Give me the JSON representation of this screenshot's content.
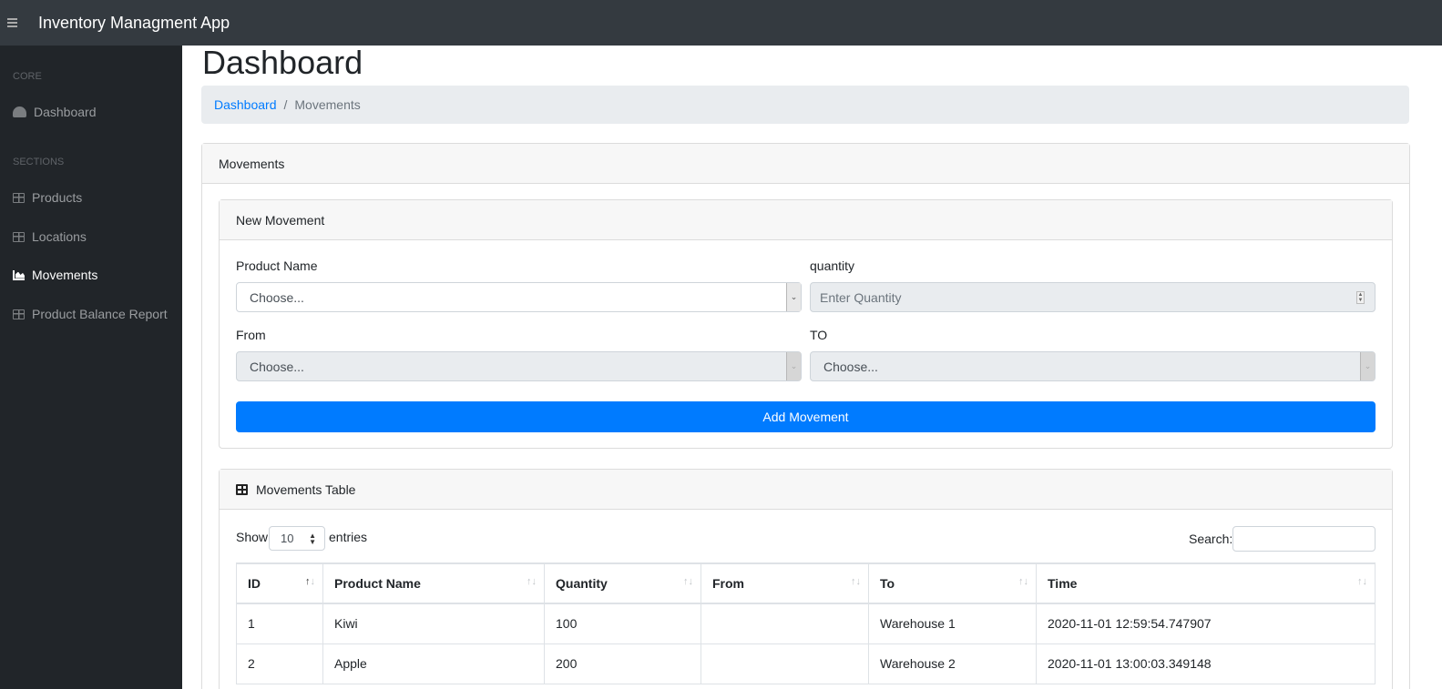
{
  "app": {
    "title": "Inventory Managment App"
  },
  "sidebar": {
    "headings": [
      "CORE",
      "SECTIONS"
    ],
    "items": [
      {
        "label": "Dashboard",
        "icon": "tachometer-icon",
        "active": false
      },
      {
        "label": "Products",
        "icon": "table-icon",
        "active": false
      },
      {
        "label": "Locations",
        "icon": "table-icon",
        "active": false
      },
      {
        "label": "Movements",
        "icon": "area-chart-icon",
        "active": true
      },
      {
        "label": "Product Balance Report",
        "icon": "table-icon",
        "active": false
      }
    ]
  },
  "page": {
    "title": "Dashboard",
    "breadcrumb": [
      {
        "label": "Dashboard",
        "link": true
      },
      {
        "label": "Movements",
        "link": false
      }
    ]
  },
  "movements_card": {
    "title": "Movements"
  },
  "new_movement": {
    "title": "New Movement",
    "product_label": "Product Name",
    "product_value": "Choose...",
    "quantity_label": "quantity",
    "quantity_placeholder": "Enter Quantity",
    "from_label": "From",
    "from_value": "Choose...",
    "to_label": "TO",
    "to_value": "Choose...",
    "submit_label": "Add Movement"
  },
  "movements_table": {
    "title": "Movements Table",
    "show_label": "Show",
    "entries_value": "10",
    "entries_label": "entries",
    "search_label": "Search:",
    "search_value": "",
    "columns": [
      "ID",
      "Product Name",
      "Quantity",
      "From",
      "To",
      "Time"
    ],
    "rows": [
      [
        "1",
        "Kiwi",
        "100",
        "",
        "Warehouse 1",
        "2020-11-01 12:59:54.747907"
      ],
      [
        "2",
        "Apple",
        "200",
        "",
        "Warehouse 2",
        "2020-11-01 13:00:03.349148"
      ]
    ]
  },
  "colors": {
    "primary": "#007bff",
    "topbar": "#343a40",
    "sidebar": "#212529"
  }
}
